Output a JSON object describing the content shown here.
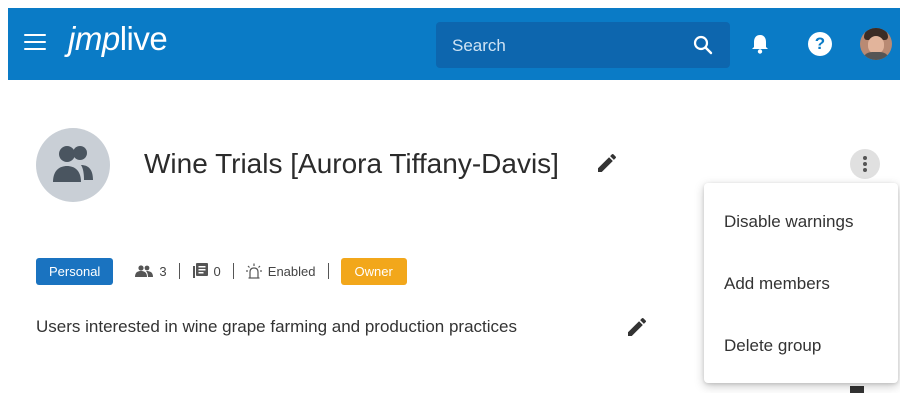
{
  "header": {
    "logo_prefix": "jmp",
    "logo_suffix": "live",
    "search_placeholder": "Search",
    "icons": [
      "menu-icon",
      "search-icon",
      "bell-icon",
      "help-icon",
      "user-avatar"
    ],
    "help_glyph": "?"
  },
  "group": {
    "title": "Wine Trials [Aurora Tiffany-Davis]",
    "type_badge": "Personal",
    "member_count": "3",
    "post_count": "0",
    "alerts_status": "Enabled",
    "role_badge": "Owner",
    "description": "Users interested in wine grape farming and production practices"
  },
  "menu": {
    "items": [
      "Disable warnings",
      "Add members",
      "Delete group"
    ]
  },
  "colors": {
    "header_bg": "#0a7bc6",
    "search_bg": "#0d66ae",
    "personal_badge": "#1a73c0",
    "owner_badge": "#f2a71b",
    "group_avatar_bg": "#c9cfd6"
  }
}
